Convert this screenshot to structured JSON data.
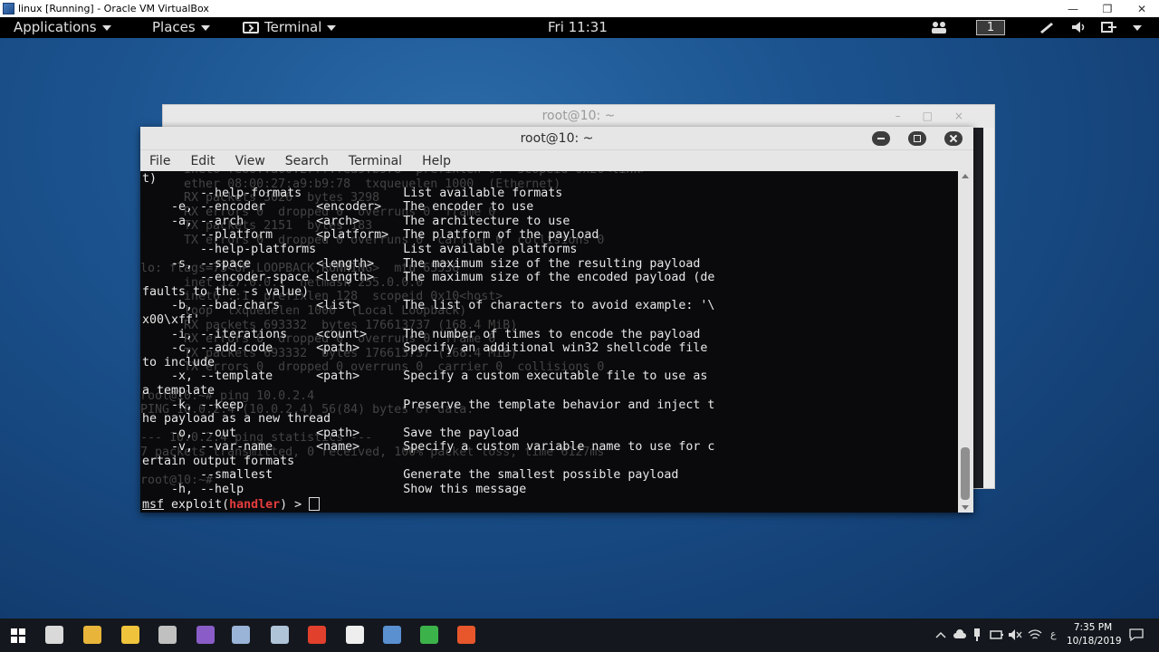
{
  "host_window": {
    "title": "linux [Running] - Oracle VM VirtualBox",
    "controls": [
      "—",
      "❐",
      "✕"
    ]
  },
  "gnome_bar": {
    "applications": "Applications",
    "places": "Places",
    "terminal": "Terminal",
    "clock": "Fri 11:31",
    "workspace": "1"
  },
  "bg_terminal": {
    "title": "root@10: ~"
  },
  "terminal": {
    "title": "root@10: ~",
    "menu": [
      "File",
      "Edit",
      "View",
      "Search",
      "Terminal",
      "Help"
    ],
    "lines": [
      "t)",
      "        --help-formats              List available formats",
      "    -e, --encoder       <encoder>   The encoder to use",
      "    -a, --arch          <arch>      The architecture to use",
      "        --platform      <platform>  The platform of the payload",
      "        --help-platforms            List available platforms",
      "    -s, --space         <length>    The maximum size of the resulting payload",
      "        --encoder-space <length>    The maximum size of the encoded payload (de",
      "faults to the -s value)",
      "    -b, --bad-chars     <list>      The list of characters to avoid example: '\\",
      "x00\\xff'",
      "    -i, --iterations    <count>     The number of times to encode the payload",
      "    -c, --add-code      <path>      Specify an additional win32 shellcode file",
      "to include",
      "    -x, --template      <path>      Specify a custom executable file to use as",
      "a template",
      "    -k, --keep                      Preserve the template behavior and inject t",
      "he payload as a new thread",
      "    -o, --out           <path>      Save the payload",
      "    -v, --var-name      <name>      Specify a custom variable name to use for c",
      "ertain output formats",
      "        --smallest                  Generate the smallest possible payload",
      "    -h, --help                      Show this message"
    ],
    "prompt": {
      "msf": "msf",
      "exploit_open": " exploit(",
      "module": "handler",
      "exploit_close": ") > "
    },
    "ghost_lines": [
      "      inet6 fe80::a00:27ff:fea9:b978  prefixlen 64  scopeid 0x20<link>",
      "      ether 08:00:27:a9:b9:78  txqueuelen 1000  (Ethernet)",
      "      RX packets 3026  bytes 3298",
      "      RX errors 0  dropped 0  overruns 0  frame 0",
      "      TX packets 2151  bytes 183",
      "      TX errors 0  dropped 0 overruns 0  carrier 0  collisions 0",
      "",
      "lo: flags=73<UP,LOOPBACK,RUNNING>  mtu 65536",
      "      inet 127.0.0.1  netmask 255.0.0.0",
      "      inet6 ::1  prefixlen 128  scopeid 0x10<host>",
      "      loop  txqueuelen 1000  (Local Loopback)",
      "      RX packets 693332  bytes 176613737 (168.4 MiB)",
      "      RX errors 0  dropped 0  overruns 0  frame 0",
      "      TX packets 693332  bytes 176613737 (168.4 MiB)",
      "      TX errors 0  dropped 0 overruns 0  carrier 0  collisions 0",
      "",
      "root@10:~# ping 10.0.2.4",
      "PING 10.0.2.4 (10.0.2.4) 56(84) bytes of data.",
      "",
      "--- 10.0.2.4 ping statistics ---",
      "7 packets transmitted, 0 received, 100% packet loss, time 6127ms",
      "",
      "root@10:~#"
    ]
  },
  "taskbar": {
    "apps": [
      {
        "icon": "task-view-icon",
        "color": "#d9d9d9"
      },
      {
        "icon": "chrome-icon",
        "color": "#e8b53a"
      },
      {
        "icon": "file-explorer-icon",
        "color": "#f0c33c"
      },
      {
        "icon": "app-icon",
        "color": "#c0c0c0"
      },
      {
        "icon": "visual-studio-icon",
        "color": "#8a5cc7"
      },
      {
        "icon": "virtualbox-icon",
        "color": "#9ab4d8"
      },
      {
        "icon": "tool-icon",
        "color": "#b0c4d8"
      },
      {
        "icon": "red-app-icon",
        "color": "#e0402c"
      },
      {
        "icon": "clapper-icon",
        "color": "#eeeeee"
      },
      {
        "icon": "cube-icon",
        "color": "#5a8fd0"
      },
      {
        "icon": "green-app-icon",
        "color": "#3cb34a"
      },
      {
        "icon": "orange-app-icon",
        "color": "#e8562c"
      }
    ],
    "tray": {
      "ime": "ع"
    },
    "time": "7:35 PM",
    "date": "10/18/2019"
  }
}
